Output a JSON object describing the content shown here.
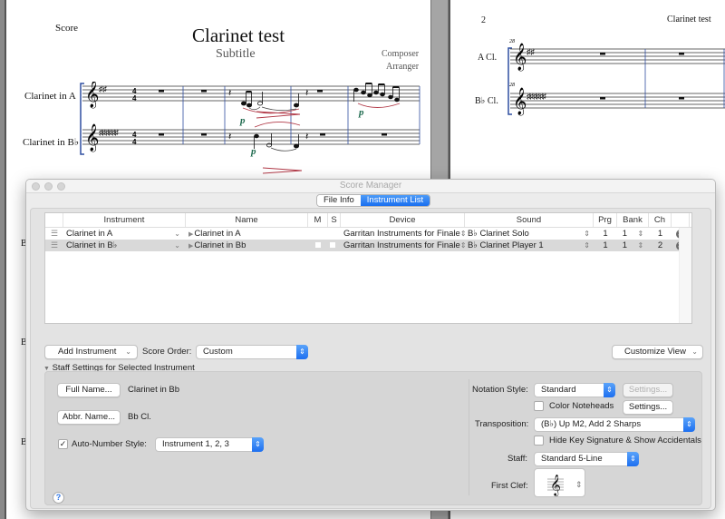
{
  "score_page1": {
    "header_label": "Score",
    "title": "Clarinet test",
    "subtitle": "Subtitle",
    "composer": "Composer",
    "arranger": "Arranger",
    "staff_labels": [
      "Clarinet in A",
      "Clarinet in B♭"
    ],
    "dynamics": [
      "p",
      "p",
      "p"
    ],
    "left_margin_letters": [
      "B",
      "B",
      "B"
    ]
  },
  "score_page2": {
    "page_number": "2",
    "running_title": "Clarinet test",
    "measure_number": "28",
    "staff_labels": [
      "A Cl.",
      "B♭ Cl."
    ]
  },
  "dialog": {
    "title": "Score Manager",
    "tabs": [
      {
        "label": "File Info",
        "selected": false
      },
      {
        "label": "Instrument List",
        "selected": true
      }
    ],
    "table": {
      "columns": [
        "Instrument",
        "Name",
        "M",
        "S",
        "Device",
        "Sound",
        "Prg",
        "Bank",
        "Ch"
      ],
      "rows": [
        {
          "instrument": "Clarinet in A",
          "name": "Clarinet in A",
          "device": "Garritan Instruments for Finale",
          "sound": "B♭ Clarinet Solo",
          "prg": "1",
          "bank": "1",
          "ch": "1",
          "selected": false
        },
        {
          "instrument": "Clarinet in B♭",
          "name": "Clarinet in Bb",
          "device": "Garritan Instruments for Finale",
          "sound": "B♭ Clarinet Player 1",
          "prg": "1",
          "bank": "1",
          "ch": "2",
          "selected": true
        }
      ]
    },
    "add_instrument_label": "Add Instrument",
    "score_order_label": "Score Order:",
    "score_order_value": "Custom",
    "customize_view_label": "Customize View",
    "staff_settings_header": "Staff Settings for Selected Instrument",
    "full_name_button": "Full Name...",
    "full_name_value": "Clarinet in Bb",
    "abbr_name_button": "Abbr. Name...",
    "abbr_name_value": "Bb Cl.",
    "auto_number_label": "Auto-Number Style:",
    "auto_number_checked": true,
    "auto_number_value": "Instrument 1, 2, 3",
    "notation_style_label": "Notation Style:",
    "notation_style_value": "Standard",
    "settings_disabled_label": "Settings...",
    "color_noteheads_label": "Color Noteheads",
    "color_noteheads_checked": false,
    "settings_label": "Settings...",
    "transposition_label": "Transposition:",
    "transposition_value": "(B♭) Up M2, Add 2 Sharps",
    "hide_key_sig_label": "Hide Key Signature & Show Accidentals",
    "hide_key_sig_checked": false,
    "staff_label": "Staff:",
    "staff_value": "Standard 5-Line",
    "first_clef_label": "First Clef:",
    "help_label": "?"
  },
  "icons": {
    "checkmark": "✓",
    "chevron_down": "⌄",
    "disclosure_triangle": "▼",
    "row_triangle": "▶",
    "stepper": "⇕",
    "delete": "✕",
    "handle": "☰",
    "treble_clef": "𝄞"
  },
  "colors": {
    "accent_blue": "#1a6ff0",
    "dynamics_green": "#1f6b4f",
    "slur_red": "#b23a48",
    "staff_bracket_blue": "#2f4fa0"
  }
}
